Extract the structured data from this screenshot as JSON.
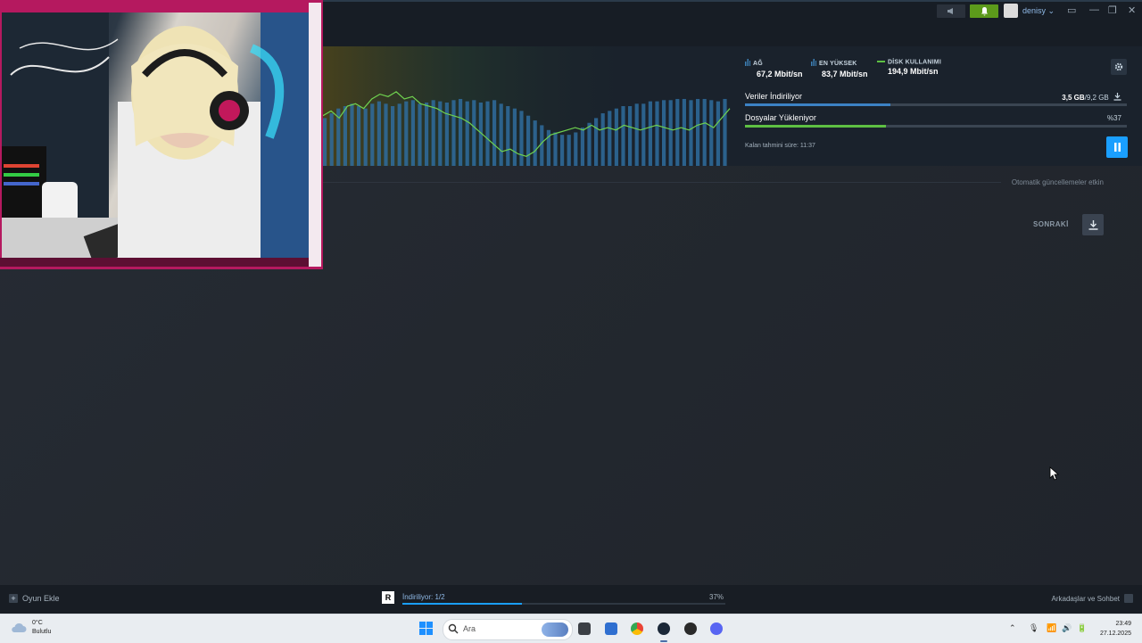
{
  "topbar": {
    "username": "denisy",
    "username_caret": "⌄",
    "window_controls": [
      "▭",
      "—",
      "❐",
      "✕"
    ]
  },
  "download_panel": {
    "stats": [
      {
        "label": "AĞ",
        "value": "67,2 Mbit/sn",
        "color": "#3c7fb4"
      },
      {
        "label": "EN YÜKSEK",
        "value": "83,7 Mbit/sn",
        "color": "#3c7fb4"
      },
      {
        "label": "DİSK KULLANIMI",
        "value": "194,9 Mbit/sn",
        "color": "#5ec043"
      }
    ],
    "rows": [
      {
        "title": "Veriler İndiriliyor",
        "right": "3,5 GB",
        "right_total": "/9,2 GB",
        "progress": 0.38,
        "color": "#3c82c4"
      },
      {
        "title": "Dosyalar Yükleniyor",
        "right": "%37",
        "right_total": "",
        "progress": 0.37,
        "color": "#5ec043"
      }
    ],
    "eta": "Kalan tahmini süre: 11:37",
    "network_bars": [
      0.4,
      0.44,
      0.48,
      0.5,
      0.52,
      0.5,
      0.48,
      0.52,
      0.54,
      0.52,
      0.5,
      0.52,
      0.54,
      0.55,
      0.52,
      0.53,
      0.55,
      0.54,
      0.53,
      0.55,
      0.56,
      0.54,
      0.55,
      0.53,
      0.54,
      0.55,
      0.52,
      0.5,
      0.48,
      0.46,
      0.42,
      0.38,
      0.34,
      0.3,
      0.28,
      0.26,
      0.26,
      0.28,
      0.32,
      0.36,
      0.4,
      0.44,
      0.46,
      0.48,
      0.5,
      0.5,
      0.52,
      0.52,
      0.54,
      0.54,
      0.55,
      0.55,
      0.56,
      0.56,
      0.55,
      0.56,
      0.56,
      0.55,
      0.54,
      0.56
    ],
    "disk_line": [
      0.42,
      0.46,
      0.4,
      0.5,
      0.52,
      0.48,
      0.56,
      0.6,
      0.58,
      0.62,
      0.56,
      0.58,
      0.52,
      0.5,
      0.48,
      0.44,
      0.42,
      0.4,
      0.36,
      0.3,
      0.24,
      0.18,
      0.12,
      0.14,
      0.1,
      0.08,
      0.12,
      0.2,
      0.26,
      0.28,
      0.3,
      0.32,
      0.3,
      0.34,
      0.3,
      0.32,
      0.3,
      0.34,
      0.32,
      0.3,
      0.32,
      0.34,
      0.32,
      0.3,
      0.32,
      0.3,
      0.34,
      0.36,
      0.32,
      0.4,
      0.48
    ]
  },
  "main": {
    "auto_updates": "Otomatik güncellemeler etkin",
    "next_label": "SONRAKİ"
  },
  "bottombar": {
    "add_game": "Oyun Ekle",
    "download_status": "İndiriliyor: 1/2",
    "download_percent": "37%",
    "download_progress": 0.37,
    "friends": "Arkadaşlar ve Sohbet"
  },
  "taskbar": {
    "temperature": "0°C",
    "weather": "Bulutlu",
    "search_placeholder": "Ara",
    "time": "23:49",
    "date": "27.12.2025"
  }
}
